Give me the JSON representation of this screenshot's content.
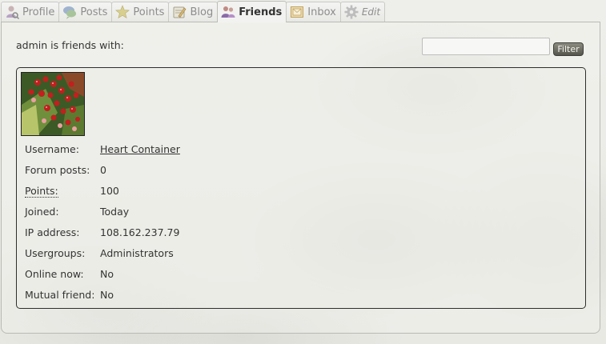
{
  "tabs": [
    {
      "label": "Profile",
      "icon": "profile-icon",
      "active": false
    },
    {
      "label": "Posts",
      "icon": "posts-icon",
      "active": false
    },
    {
      "label": "Points",
      "icon": "star-icon",
      "active": false
    },
    {
      "label": "Blog",
      "icon": "blog-icon",
      "active": false
    },
    {
      "label": "Friends",
      "icon": "friends-icon",
      "active": true
    },
    {
      "label": "Inbox",
      "icon": "inbox-icon",
      "active": false
    },
    {
      "label": "Edit",
      "icon": "gear-icon",
      "active": false
    }
  ],
  "header": {
    "heading": "admin is friends with:",
    "filter_value": "",
    "filter_button": "Filter"
  },
  "friend": {
    "avatar": "berries-avatar",
    "rows": [
      {
        "label": "Username:",
        "value": "Heart Container",
        "link": true
      },
      {
        "label": "Forum posts:",
        "value": "0"
      },
      {
        "label": "Points:",
        "value": "100",
        "dotted": true
      },
      {
        "label": "Joined:",
        "value": "Today"
      },
      {
        "label": "IP address:",
        "value": "108.162.237.79"
      },
      {
        "label": "Usergroups:",
        "value": "Administrators"
      },
      {
        "label": "Online now:",
        "value": "No"
      },
      {
        "label": "Mutual friend:",
        "value": "No"
      }
    ]
  },
  "colors": {
    "button_bg": "#6b6b60",
    "card_border": "#2e2e2e"
  }
}
